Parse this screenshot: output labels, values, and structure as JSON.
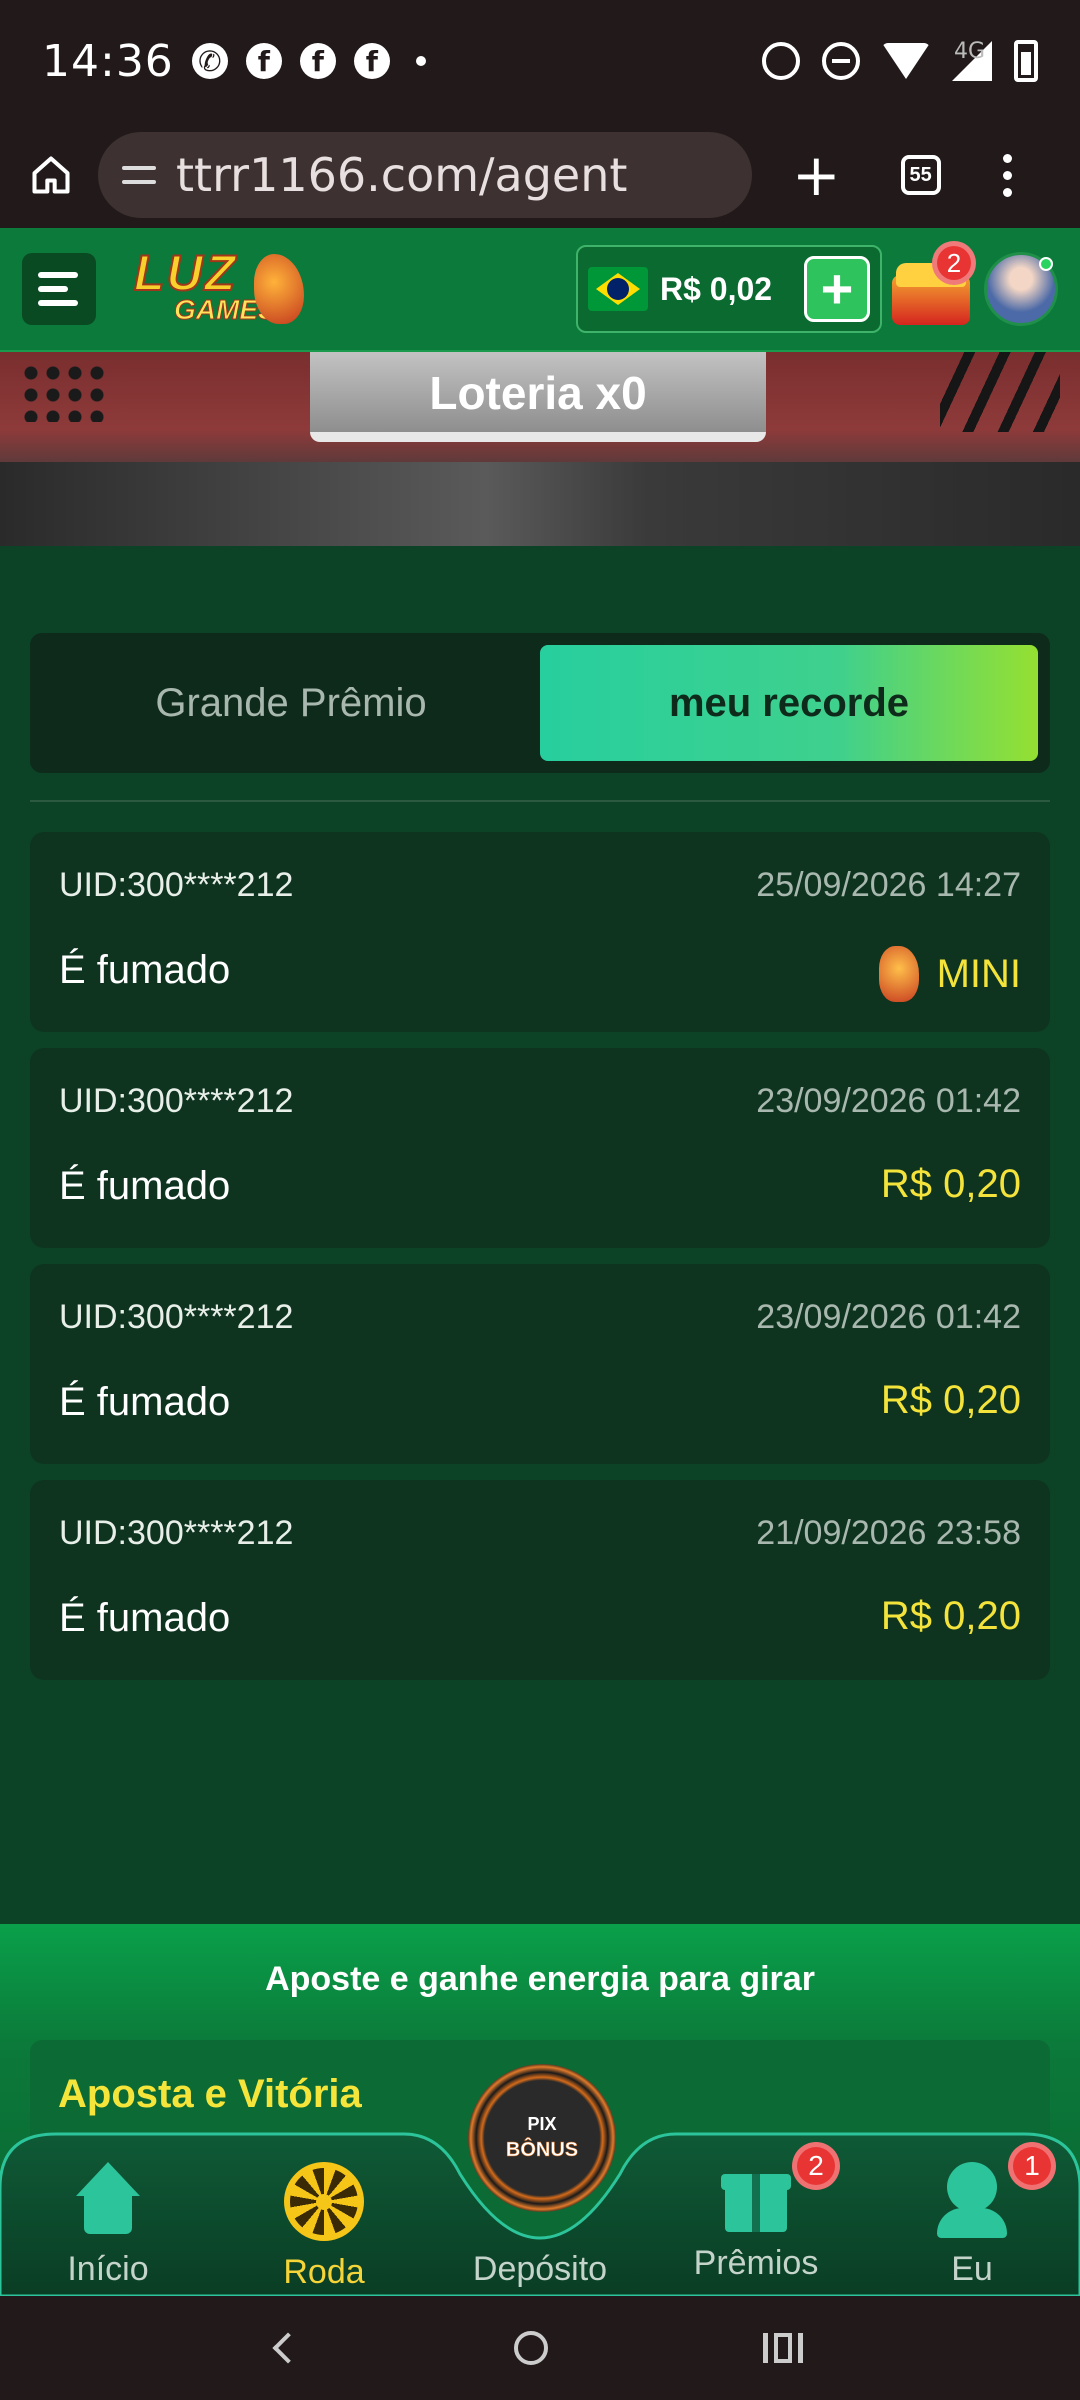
{
  "status_bar": {
    "time": "14:36",
    "network": "4G",
    "notification_icons": [
      "whatsapp-icon",
      "facebook-icon",
      "facebook-icon",
      "facebook-icon"
    ]
  },
  "browser": {
    "url": "ttrr1166.com/agent",
    "tabs_count": "55"
  },
  "header": {
    "brand_top": "LUZ",
    "brand_bottom": "GAMES",
    "balance": "R$ 0,02",
    "chest_badge": "2"
  },
  "banner": {
    "lottery_label": "Loteria x0"
  },
  "tabs": {
    "grand_prize": "Grande Prêmio",
    "my_record": "meu recorde",
    "active": "meu recorde"
  },
  "records": [
    {
      "uid": "UID:300****212",
      "date": "25/09/2026 14:27",
      "label": "É fumado",
      "prize": "MINI"
    },
    {
      "uid": "UID:300****212",
      "date": "23/09/2026 01:42",
      "label": "É fumado",
      "prize": "R$ 0,20"
    },
    {
      "uid": "UID:300****212",
      "date": "23/09/2026 01:42",
      "label": "É fumado",
      "prize": "R$ 0,20"
    },
    {
      "uid": "UID:300****212",
      "date": "21/09/2026 23:58",
      "label": "É fumado",
      "prize": "R$ 0,20"
    }
  ],
  "promo": {
    "title": "Aposte e ganhe energia para girar",
    "card_title": "Aposta e Vitória"
  },
  "tabbar": {
    "inicio": "Início",
    "roda": "Roda",
    "deposito": "Depósito",
    "premios": "Prêmios",
    "eu": "Eu",
    "premios_badge": "2",
    "eu_badge": "1",
    "deposit_coin_top": "PIX",
    "deposit_coin_bottom": "BÔNUS"
  },
  "colors": {
    "accent_yellow": "#f3e33a",
    "brand_green": "#0b7a3a",
    "tab_gradient_start": "#27cf9e",
    "tab_gradient_end": "#95e031"
  }
}
